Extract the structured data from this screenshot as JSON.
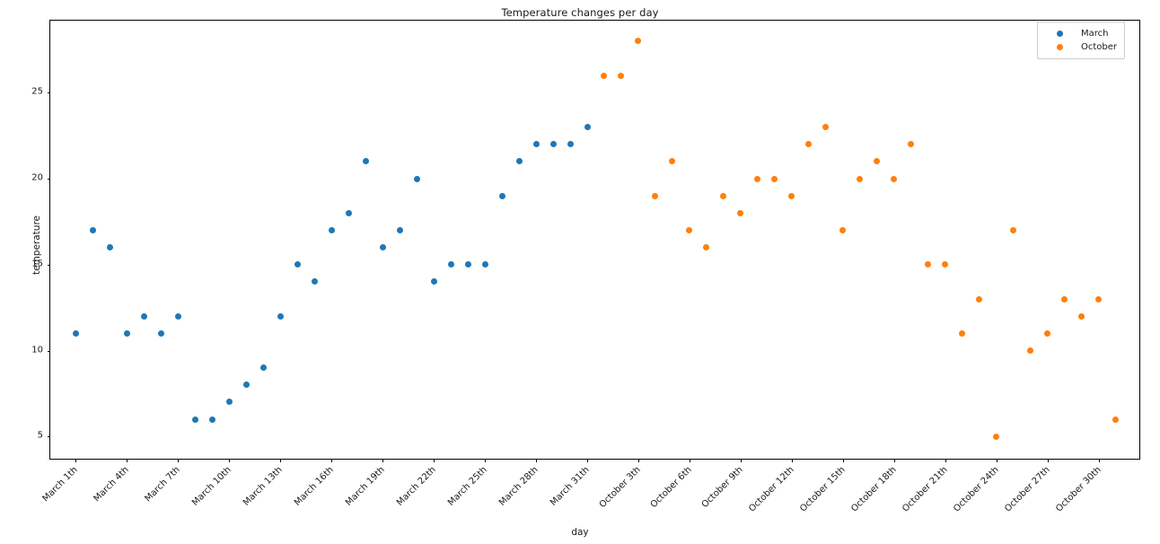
{
  "chart_data": {
    "type": "scatter",
    "title": "Temperature changes per day",
    "xlabel": "day",
    "ylabel": "temperature",
    "ylim": [
      3.6,
      29.2
    ],
    "yticks": [
      5,
      10,
      15,
      20,
      25
    ],
    "grid": false,
    "legend_position": "upper right",
    "xtick_labels": [
      "March 1th",
      "March 4th",
      "March 7th",
      "March 10th",
      "March 13th",
      "March 16th",
      "March 19th",
      "March 22th",
      "March 25th",
      "March 28th",
      "March 31th",
      "October 3th",
      "October 6th",
      "October 9th",
      "October 12th",
      "October 15th",
      "October 18th",
      "October 21th",
      "October 24th",
      "October 27th",
      "October 30th"
    ],
    "series": [
      {
        "name": "March",
        "color": "#1f77b4",
        "x": [
          "March 1th",
          "March 2th",
          "March 3th",
          "March 4th",
          "March 5th",
          "March 6th",
          "March 7th",
          "March 8th",
          "March 9th",
          "March 10th",
          "March 11th",
          "March 12th",
          "March 13th",
          "March 14th",
          "March 15th",
          "March 16th",
          "March 17th",
          "March 18th",
          "March 19th",
          "March 20th",
          "March 21th",
          "March 22th",
          "March 23th",
          "March 24th",
          "March 25th",
          "March 26th",
          "March 27th",
          "March 28th",
          "March 29th",
          "March 30th",
          "March 31th"
        ],
        "values": [
          11,
          17,
          16,
          11,
          12,
          11,
          12,
          6,
          6,
          7,
          8,
          9,
          12,
          15,
          14,
          17,
          18,
          21,
          16,
          17,
          20,
          14,
          15,
          15,
          15,
          19,
          21,
          22,
          22,
          22,
          23
        ]
      },
      {
        "name": "October",
        "color": "#ff7f0e",
        "x": [
          "October 1th",
          "October 2th",
          "October 3th",
          "October 4th",
          "October 5th",
          "October 6th",
          "October 7th",
          "October 8th",
          "October 9th",
          "October 10th",
          "October 11th",
          "October 12th",
          "October 13th",
          "October 14th",
          "October 15th",
          "October 16th",
          "October 17th",
          "October 18th",
          "October 19th",
          "October 20th",
          "October 21th",
          "October 22th",
          "October 23th",
          "October 24th",
          "October 25th",
          "October 26th",
          "October 27th",
          "October 28th",
          "October 29th",
          "October 30th"
        ],
        "values": [
          26,
          26,
          28,
          19,
          21,
          17,
          16,
          19,
          18,
          20,
          20,
          19,
          22,
          23,
          17,
          20,
          21,
          20,
          22,
          15,
          15,
          11,
          13,
          5,
          17,
          10,
          11,
          13,
          12,
          13
        ]
      }
    ],
    "extra_points": [
      {
        "series": "October",
        "x": "October 31th",
        "value": 6
      }
    ]
  },
  "legend": {
    "entries": [
      {
        "label": "March",
        "color": "#1f77b4"
      },
      {
        "label": "October",
        "color": "#ff7f0e"
      }
    ]
  }
}
